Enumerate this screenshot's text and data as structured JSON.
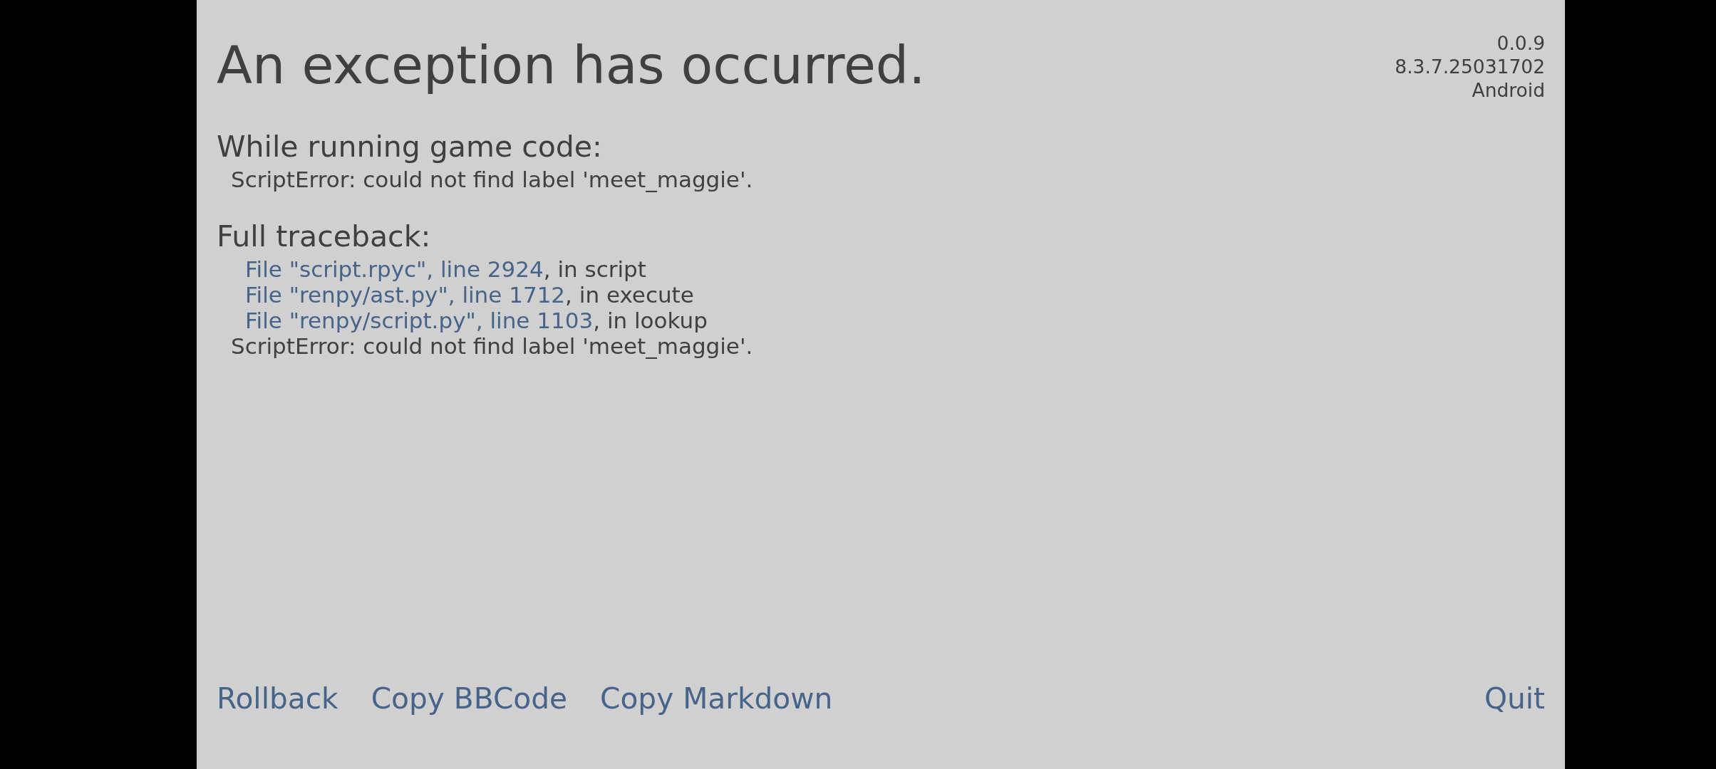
{
  "title": "An exception has occurred.",
  "version_info": [
    "0.0.9",
    "8.3.7.25031702",
    "Android"
  ],
  "sections": [
    {
      "heading": "While running game code:",
      "lines": [
        {
          "kind": "message",
          "text": "ScriptError: could not find label 'meet_maggie'."
        }
      ]
    },
    {
      "heading": "Full traceback:",
      "lines": [
        {
          "kind": "frame",
          "location": "File \"script.rpyc\", line 2924",
          "context": ", in script"
        },
        {
          "kind": "frame",
          "location": "File \"renpy/ast.py\", line 1712",
          "context": ", in execute"
        },
        {
          "kind": "frame",
          "location": "File \"renpy/script.py\", line 1103",
          "context": ", in lookup"
        },
        {
          "kind": "message",
          "text": "ScriptError: could not find label 'meet_maggie'."
        }
      ]
    }
  ],
  "actions": [
    {
      "label": "Rollback"
    },
    {
      "label": "Copy BBCode"
    },
    {
      "label": "Copy Markdown"
    }
  ],
  "quit_button": {
    "label": "Quit"
  }
}
